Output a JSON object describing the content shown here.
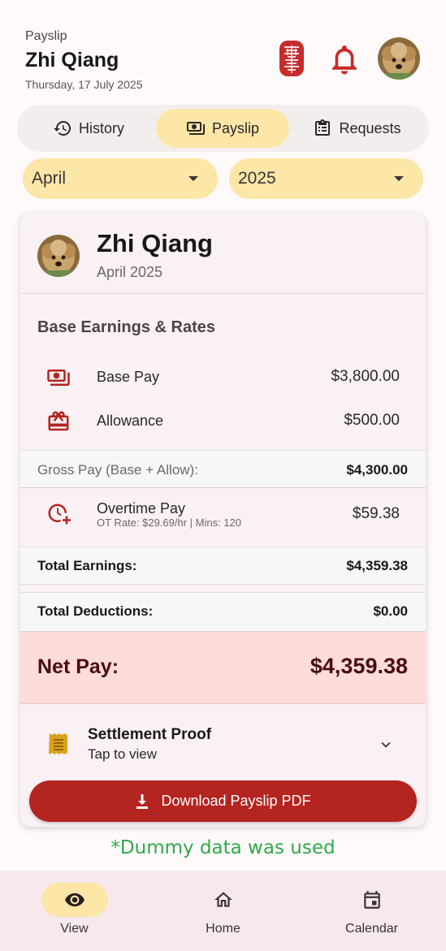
{
  "header": {
    "kicker": "Payslip",
    "title": "Zhi Qiang",
    "date": "Thursday, 17 July 2025",
    "icons": [
      "seal-logo",
      "bell-icon",
      "avatar"
    ]
  },
  "tabs": [
    {
      "label": "History",
      "icon": "history-icon",
      "active": false
    },
    {
      "label": "Payslip",
      "icon": "payments-icon",
      "active": true
    },
    {
      "label": "Requests",
      "icon": "clipboard-icon",
      "active": false
    }
  ],
  "filters": {
    "month": "April",
    "year": "2025"
  },
  "employee": {
    "name": "Zhi Qiang",
    "period": "April 2025"
  },
  "earnings": {
    "section_title": "Base Earnings & Rates",
    "base_pay": {
      "label": "Base Pay",
      "value": "$3,800.00"
    },
    "allowance": {
      "label": "Allowance",
      "value": "$500.00"
    },
    "gross": {
      "label": "Gross Pay (Base + Allow):",
      "value": "$4,300.00"
    },
    "overtime": {
      "label": "Overtime Pay",
      "sub": "OT Rate: $29.69/hr | Mins: 120",
      "value": "$59.38"
    },
    "total_earnings": {
      "label": "Total Earnings:",
      "value": "$4,359.38"
    },
    "total_deductions": {
      "label": "Total Deductions:",
      "value": "$0.00"
    },
    "net_pay": {
      "label": "Net Pay:",
      "value": "$4,359.38"
    }
  },
  "settlement": {
    "title": "Settlement Proof",
    "subtitle": "Tap to view"
  },
  "download_label": "Download Payslip PDF",
  "dummy_note": "*Dummy data was used",
  "bottom_nav": [
    {
      "label": "View",
      "icon": "eye-icon",
      "active": true
    },
    {
      "label": "Home",
      "icon": "home-icon",
      "active": false
    },
    {
      "label": "Calendar",
      "icon": "calendar-icon",
      "active": false
    }
  ],
  "colors": {
    "accent_yellow": "#fce6a8",
    "brand_red": "#b42420",
    "net_pay_bg": "#fddcda",
    "dummy_green": "#2eaa4a"
  }
}
